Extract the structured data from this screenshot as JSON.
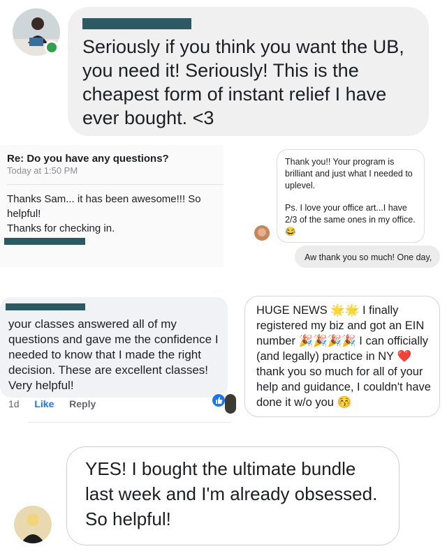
{
  "testimonial_top": {
    "text": "Seriously if you think you want the UB, you need it! Seriously! This is the cheapest form of instant relief I have ever bought. <3"
  },
  "email": {
    "subject": "Re: Do you have any questions?",
    "time": "Today at 1:50 PM",
    "body_line1": "Thanks Sam... it has been awesome!!! So helpful!",
    "body_line2": "Thanks for checking in."
  },
  "chat": {
    "message_1": "Thank you!! Your program is brilliant and just what I needed to uplevel.",
    "message_2": "Ps. I love your office art...I have 2/3 of the same ones in my office. 😂",
    "reply": "Aw thank you so much! One day,"
  },
  "fb_comment": {
    "text": "your classes answered all of my questions and gave me the confidence I needed to know that I made the right decision. These are excellent classes! Very helpful!",
    "time": "1d",
    "like": "Like",
    "reply": "Reply"
  },
  "news": {
    "text": "HUGE NEWS 🌟🌟 I finally registered my biz and got an EIN number 🎉🎉🎉🎉 I can officially (and legally) practice in NY ❤️ thank you so much for all of your help and guidance, I couldn't have done it w/o you 😚"
  },
  "testimonial_bottom": {
    "text": "YES! I bought the ultimate bundle last week and I'm already obsessed.   So helpful!"
  },
  "colors": {
    "redaction": "#2d5963",
    "online_dot": "#31a24c",
    "fb_blue": "#1877f2"
  }
}
